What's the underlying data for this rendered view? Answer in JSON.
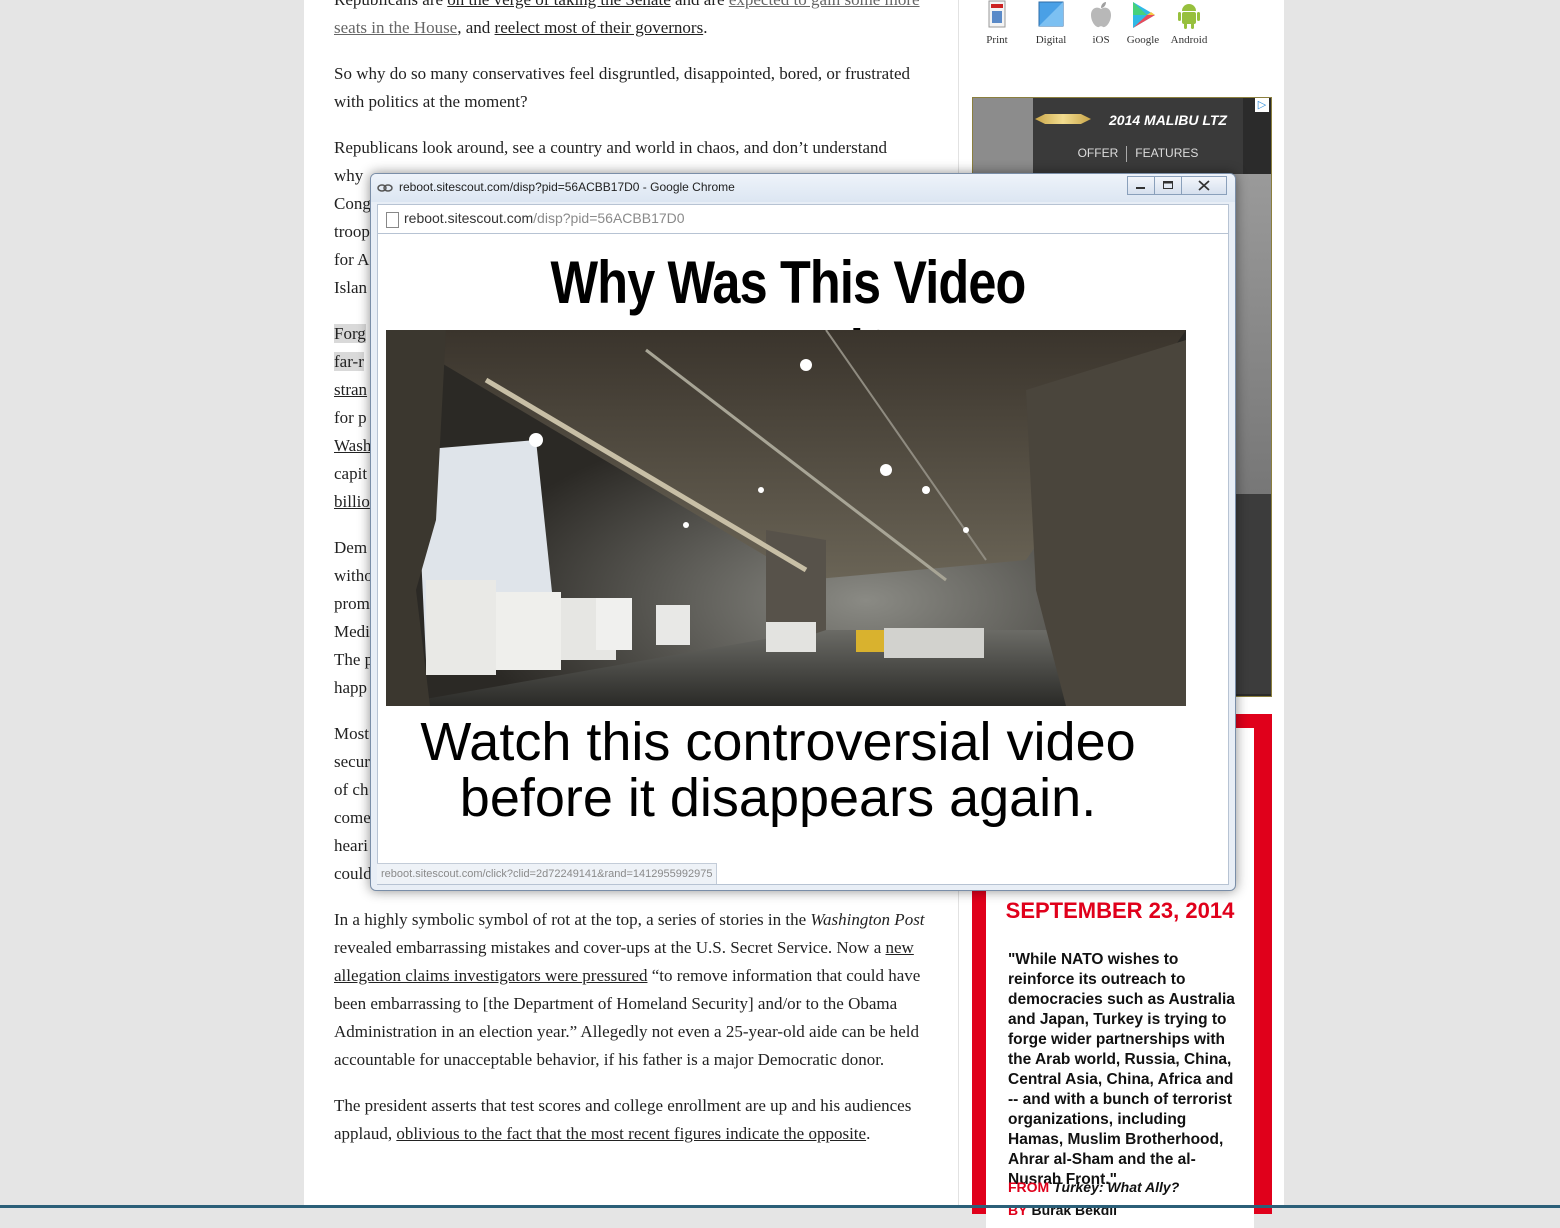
{
  "article": {
    "p1": {
      "t1": "Republicans are ",
      "l1": "on the verge of taking the Senate",
      "t2": " and are ",
      "l2": "expected to gain some more seats in the House",
      "t3": ", and ",
      "l3": "reelect most of their governors",
      "t4": "."
    },
    "p2": "So why do so many conservatives feel disgruntled, disappointed, bored, or frustrated with politics at the moment?",
    "p3": {
      "l1": "Republicans look around, see a country and world in chaos, and don’t understand",
      "l2": "why",
      "l3": "Cong",
      "l4": "troop",
      "l5": "for A",
      "l6": "Islan"
    },
    "p4": {
      "l1": "Forg",
      "l2": "far-r",
      "l3": "stran",
      "l4": "for p",
      "l5": "Wash",
      "l6": "capit",
      "l7": "billio"
    },
    "p5": {
      "l1": "Dem",
      "l2": "witho",
      "l3": "prom",
      "l4": "Medi",
      "l5": "The p",
      "l6": "happ"
    },
    "p6": {
      "l1": "Most",
      "l2": "secur",
      "l3": "of ch",
      "l4": "come",
      "l5": "heari",
      "l6": "could"
    },
    "p7": {
      "t1": "In a highly symbolic symbol of rot at the top, a series of stories in the ",
      "i1": "Washington Post",
      "t2": " revealed embarrassing mistakes and cover-ups at the U.S. Secret Service. Now a ",
      "l1": "new allegation claims investigators were pressured",
      "t3": " “to remove information that could have been embarrassing to [the Department of Homeland Security] and/or to the Obama Administration in an election year.” Allegedly not even a 25-year-old aide can be held accountable for unacceptable behavior, if his father is a major Democratic donor."
    },
    "p8": {
      "t1": "The president asserts that test scores and college enrollment are up and his audiences applaud, ",
      "l1": "oblivious to the fact that the most recent figures indicate the opposite",
      "t2": "."
    }
  },
  "apps": [
    {
      "label": "Print",
      "icon": "print-icon"
    },
    {
      "label": "Digital",
      "icon": "digital-icon"
    },
    {
      "label": "iOS",
      "icon": "apple-icon"
    },
    {
      "label": "Google",
      "icon": "google-play-icon"
    },
    {
      "label": "Android",
      "icon": "android-icon"
    }
  ],
  "car_ad": {
    "model": "2014 MALIBU LTZ",
    "offer": "OFFER",
    "features": "FEATURES"
  },
  "quote": {
    "date": "SEPTEMBER 23, 2014",
    "text": "\"While NATO wishes to reinforce its outreach to democracies such as Australia and Japan, Turkey is trying to forge wider partnerships with the Arab world, Russia, China, Central Asia, China, Africa and -- and with a bunch of terrorist organizations, including Hamas, Muslim Brotherhood, Ahrar al-Sham and the al-Nusrah Front.\"",
    "from_label": "FROM",
    "from_title": "Turkey: What Ally?",
    "by_label": "BY",
    "by_name": "Burak Bekdil"
  },
  "popup": {
    "window_title": "reboot.sitescout.com/disp?pid=56ACBB17D0 - Google Chrome",
    "url_host": "reboot.sitescout.com",
    "url_path": "/disp?pid=56ACBB17D0",
    "headline": "Why Was This Video Banned?",
    "subtext_line1": "Watch this controversial video",
    "subtext_line2": "before it disappears again.",
    "status_url": "reboot.sitescout.com/click?clid=2d72249141&rand=1412955992975"
  }
}
